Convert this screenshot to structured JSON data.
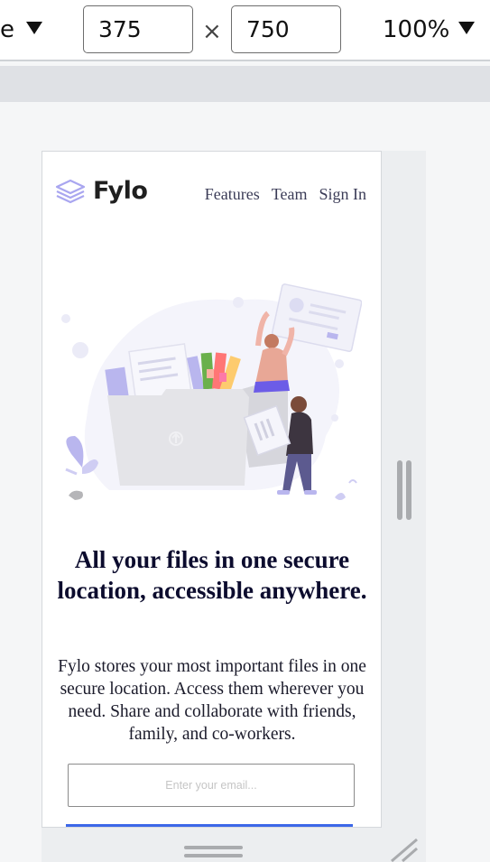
{
  "device_toolbar": {
    "device_label_fragment": "e",
    "width_value": "375",
    "height_value": "750",
    "dimension_separator": "×",
    "zoom_value": "100%",
    "dropdown_icon": "triangle-down-icon"
  },
  "page": {
    "logo": {
      "text": "Fylo",
      "icon": "layered-stack-icon"
    },
    "nav": [
      {
        "label": "Features"
      },
      {
        "label": "Team"
      },
      {
        "label": "Sign In"
      }
    ],
    "illustration": "files-illustration",
    "headline": "All your files in one secure location, accessible anywhere.",
    "description": "Fylo stores your most important files in one secure location. Access them wherever you need. Share and collaborate with friends, family, and co-workers.",
    "email_placeholder": "Enter your email...",
    "colors": {
      "cta_blue": "#3c68e8",
      "logo_purple": "#a9a6f0",
      "headline_navy": "#0c0c2e"
    }
  }
}
